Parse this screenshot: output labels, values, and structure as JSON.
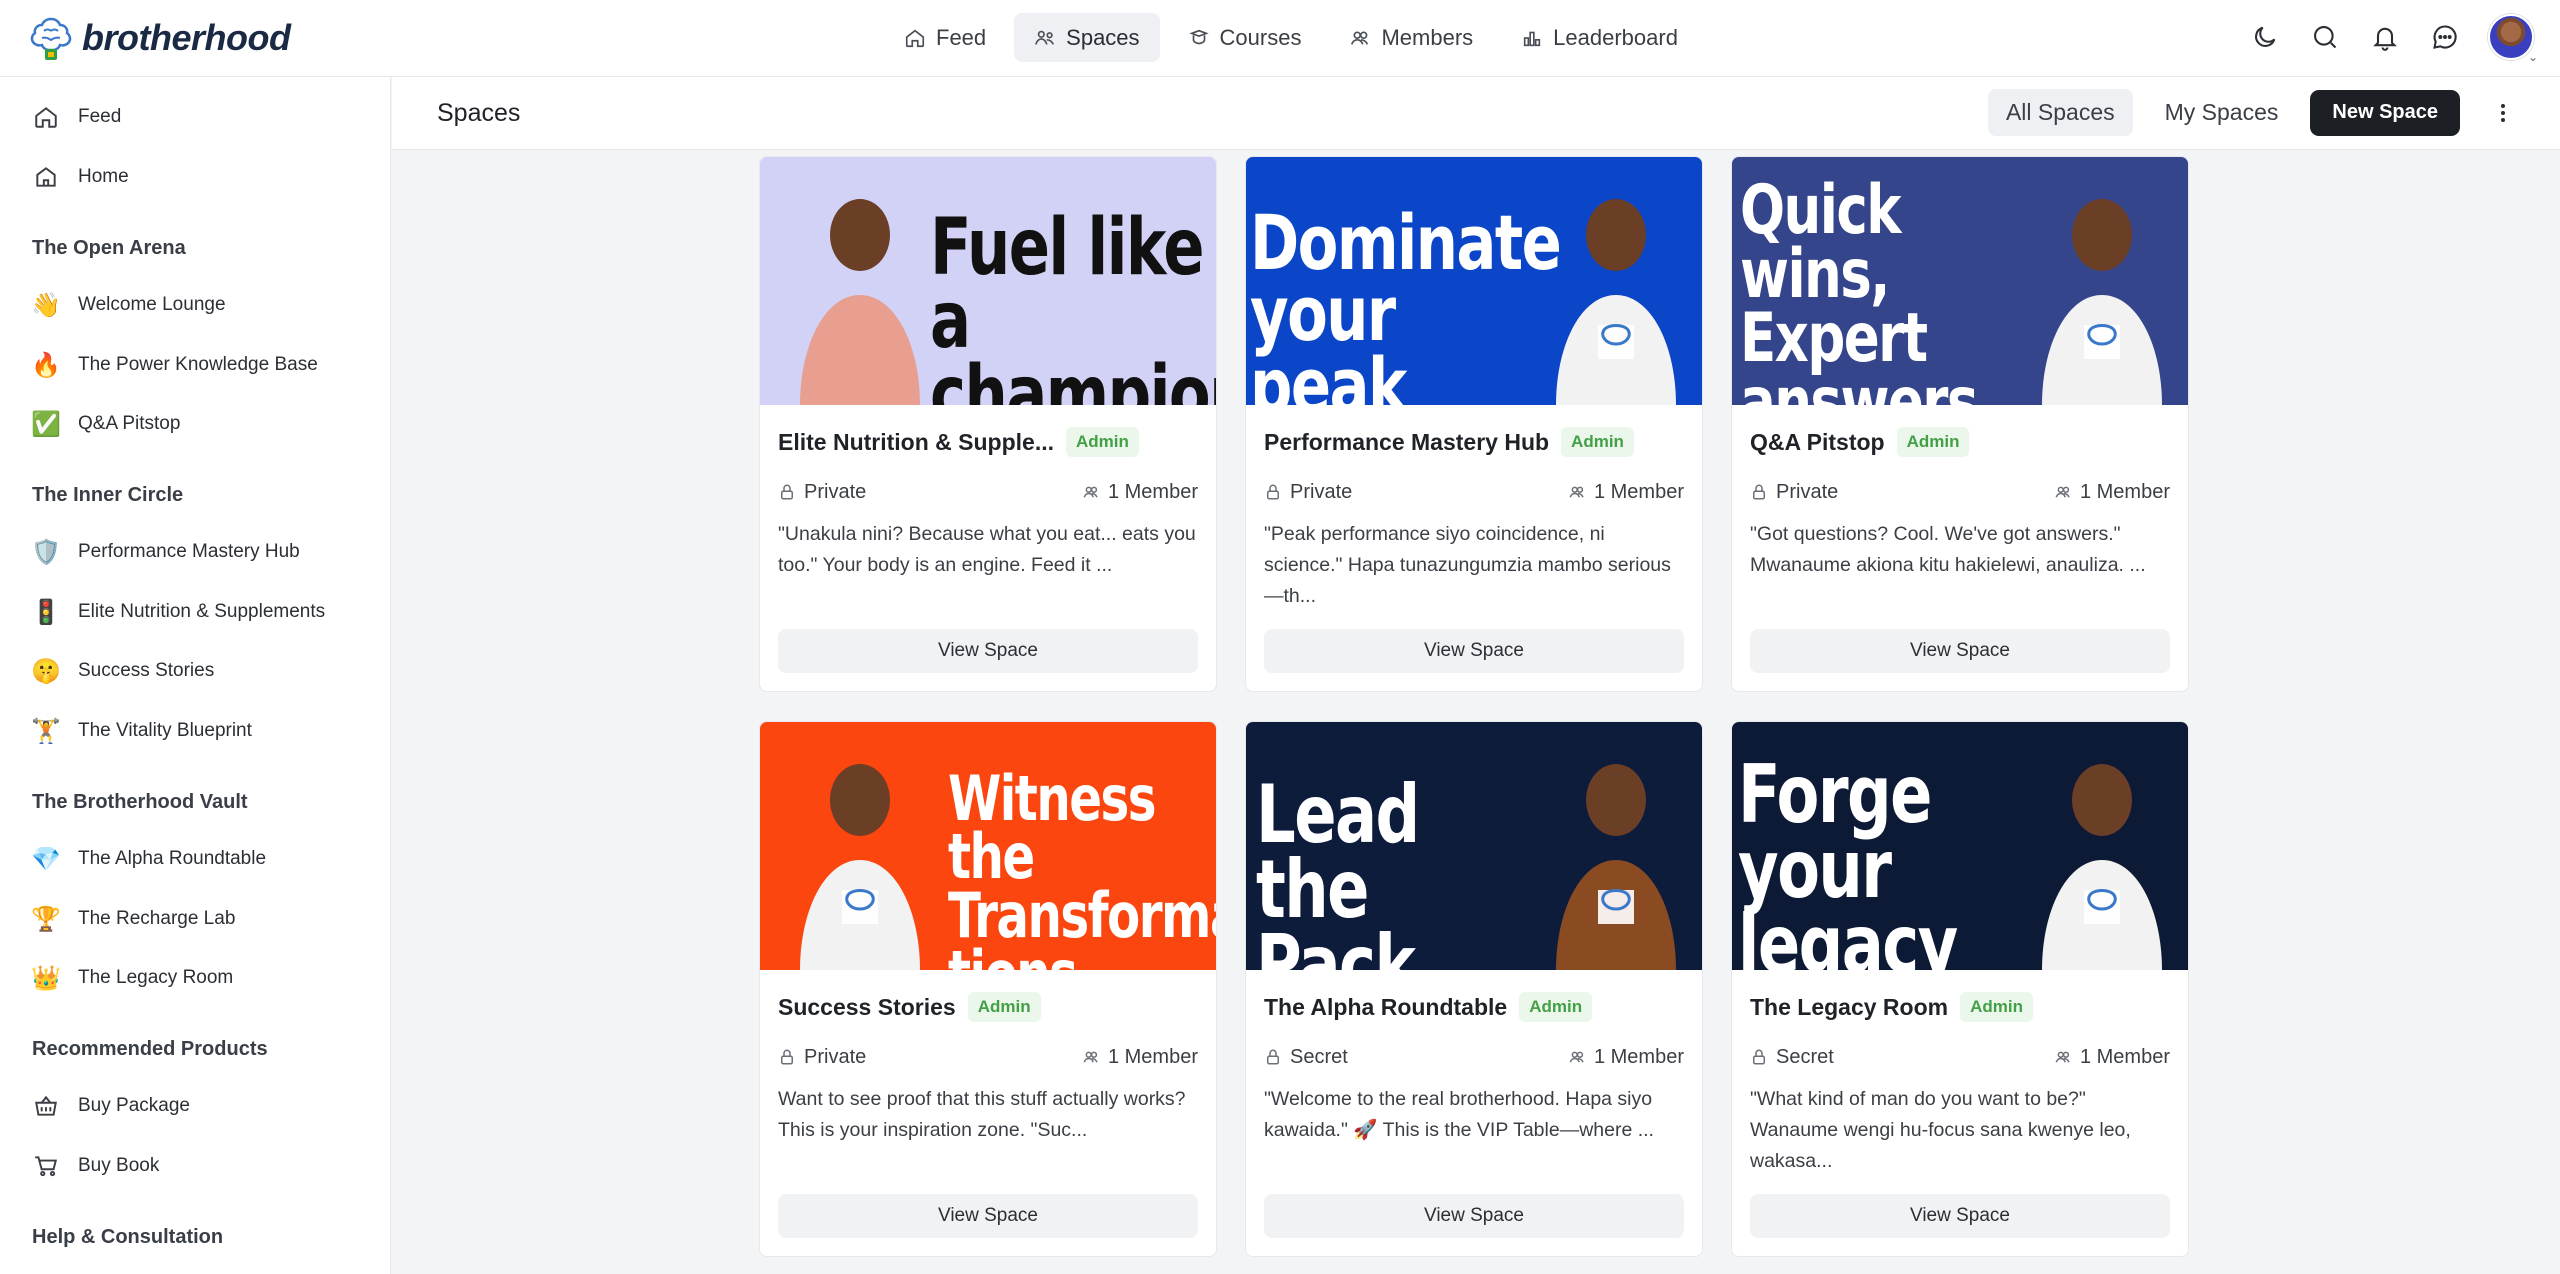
{
  "app": {
    "brand": "brotherhood"
  },
  "topnav": [
    {
      "label": "Feed",
      "icon": "home-icon",
      "active": false
    },
    {
      "label": "Spaces",
      "icon": "people-icon",
      "active": true
    },
    {
      "label": "Courses",
      "icon": "courses-icon",
      "active": false
    },
    {
      "label": "Members",
      "icon": "members-icon",
      "active": false
    },
    {
      "label": "Leaderboard",
      "icon": "leaderboard-icon",
      "active": false
    }
  ],
  "top_icons": [
    "moon-icon",
    "search-icon",
    "bell-icon",
    "chat-icon",
    "avatar"
  ],
  "sidebar": {
    "top": [
      {
        "label": "Feed",
        "icon": "home-icon"
      },
      {
        "label": "Home",
        "icon": "house-icon"
      }
    ],
    "sections": [
      {
        "title": "The Open Arena",
        "items": [
          {
            "label": "Welcome Lounge",
            "emoji": "👋"
          },
          {
            "label": "The Power Knowledge Base",
            "emoji": "🔥"
          },
          {
            "label": "Q&A Pitstop",
            "emoji": "✅"
          }
        ]
      },
      {
        "title": "The Inner Circle",
        "items": [
          {
            "label": "Performance Mastery Hub",
            "emoji": "🛡️"
          },
          {
            "label": "Elite Nutrition & Supplements",
            "emoji": "🚦"
          },
          {
            "label": "Success Stories",
            "emoji": "🤫"
          },
          {
            "label": "The Vitality Blueprint",
            "emoji": "🏋️"
          }
        ]
      },
      {
        "title": "The Brotherhood Vault",
        "items": [
          {
            "label": "The Alpha Roundtable",
            "emoji": "💎"
          },
          {
            "label": "The Recharge Lab",
            "emoji": "🏆"
          },
          {
            "label": "The Legacy Room",
            "emoji": "👑"
          }
        ]
      },
      {
        "title": "Recommended Products",
        "items": [
          {
            "label": "Buy Package",
            "icon": "basket-icon"
          },
          {
            "label": "Buy Book",
            "icon": "cart-icon"
          }
        ]
      },
      {
        "title": "Help & Consultation",
        "items": []
      }
    ]
  },
  "main": {
    "title": "Spaces",
    "filters": {
      "all": "All Spaces",
      "mine": "My Spaces"
    },
    "new_space": "New Space"
  },
  "cards": [
    {
      "title": "Elite Nutrition & Supple...",
      "badge": "Admin",
      "privacy": "Private",
      "members": "1 Member",
      "desc": "\"Unakula nini? Because what you eat... eats you too.\" Your body is an engine. Feed it ...",
      "button": "View Space",
      "banner_text": "Fuel like a champion",
      "banner_bg": "#d2d2f7",
      "banner_fg": "#111111"
    },
    {
      "title": "Performance Mastery Hub",
      "badge": "Admin",
      "privacy": "Private",
      "members": "1 Member",
      "desc": "\"Peak performance siyo coincidence, ni science.\" Hapa tunazungumzia mambo serious—th...",
      "button": "View Space",
      "banner_text": "Dominate your peak",
      "banner_bg": "#0b45c8",
      "banner_fg": "#ffffff"
    },
    {
      "title": "Q&A Pitstop",
      "badge": "Admin",
      "privacy": "Private",
      "members": "1 Member",
      "desc": "\"Got questions? Cool. We've got answers.\" Mwanaume akiona kitu hakielewi, anauliza. ...",
      "button": "View Space",
      "banner_text": "Quick wins, Expert answers",
      "banner_bg": "#34458c",
      "banner_fg": "#ffffff"
    },
    {
      "title": "Success Stories",
      "badge": "Admin",
      "privacy": "Private",
      "members": "1 Member",
      "desc": "Want to see proof that this stuff actually works? This is your inspiration zone. \"Suc...",
      "button": "View Space",
      "banner_text": "Witness the Transforma tions",
      "banner_bg": "#fb4610",
      "banner_fg": "#ffffff"
    },
    {
      "title": "The Alpha Roundtable",
      "badge": "Admin",
      "privacy": "Secret",
      "members": "1 Member",
      "desc": "\"Welcome to the real brotherhood. Hapa siyo kawaida.\" 🚀 This is the VIP Table—where ...",
      "button": "View Space",
      "banner_text": "Lead the Pack",
      "banner_bg": "#0e1c3c",
      "banner_fg": "#ffffff"
    },
    {
      "title": "The Legacy Room",
      "badge": "Admin",
      "privacy": "Secret",
      "members": "1 Member",
      "desc": "\"What kind of man do you want to be?\" Wanaume wengi hu-focus sana kwenye leo, wakasa...",
      "button": "View Space",
      "banner_text": "Forge your legacy",
      "banner_bg": "#0d1a35",
      "banner_fg": "#ffffff"
    }
  ]
}
